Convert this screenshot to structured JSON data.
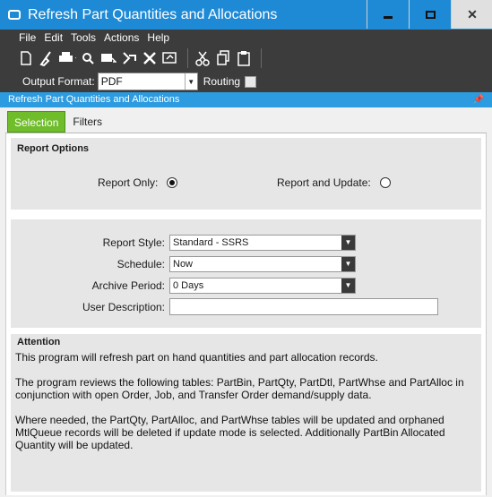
{
  "window": {
    "title": "Refresh Part Quantities and Allocations"
  },
  "menu": [
    "File",
    "Edit",
    "Tools",
    "Actions",
    "Help"
  ],
  "toolbar_icons": [
    "new-icon",
    "clear-icon",
    "print-icon",
    "print-preview-icon",
    "send-icon",
    "submit-icon",
    "tools-icon",
    "report-icon",
    "cut-icon",
    "copy-icon",
    "paste-icon"
  ],
  "format": {
    "label": "Output Format:",
    "value": "PDF",
    "routing_label": "Routing"
  },
  "panel": {
    "title": "Refresh Part Quantities and Allocations",
    "pin": "📌"
  },
  "tabs": [
    "Selection",
    "Filters"
  ],
  "report_options": {
    "title": "Report Options",
    "report_only": "Report Only:",
    "report_update": "Report and Update:"
  },
  "fields": {
    "report_style_label": "Report Style:",
    "report_style_value": "Standard - SSRS",
    "schedule_label": "Schedule:",
    "schedule_value": "Now",
    "archive_label": "Archive Period:",
    "archive_value": "0 Days",
    "user_desc_label": "User Description:",
    "user_desc_value": ""
  },
  "attention": {
    "title": "Attention",
    "p1": "This program will refresh part on hand quantities and part allocation records.",
    "p2": "The program reviews the following tables: PartBin, PartQty, PartDtl, PartWhse and PartAlloc in conjunction with open Order, Job, and Transfer Order demand/supply data.",
    "p3": "Where needed, the PartQty, PartAlloc, and PartWhse tables will be updated and orphaned MtlQueue records will be deleted if update mode is selected. Additionally PartBin Allocated Quantity will be updated."
  },
  "colors": {
    "titlebar": "#1e8ad6",
    "menubar": "#3c3c3c",
    "panelhead": "#2c9be0",
    "active_tab": "#6fbd2a"
  }
}
